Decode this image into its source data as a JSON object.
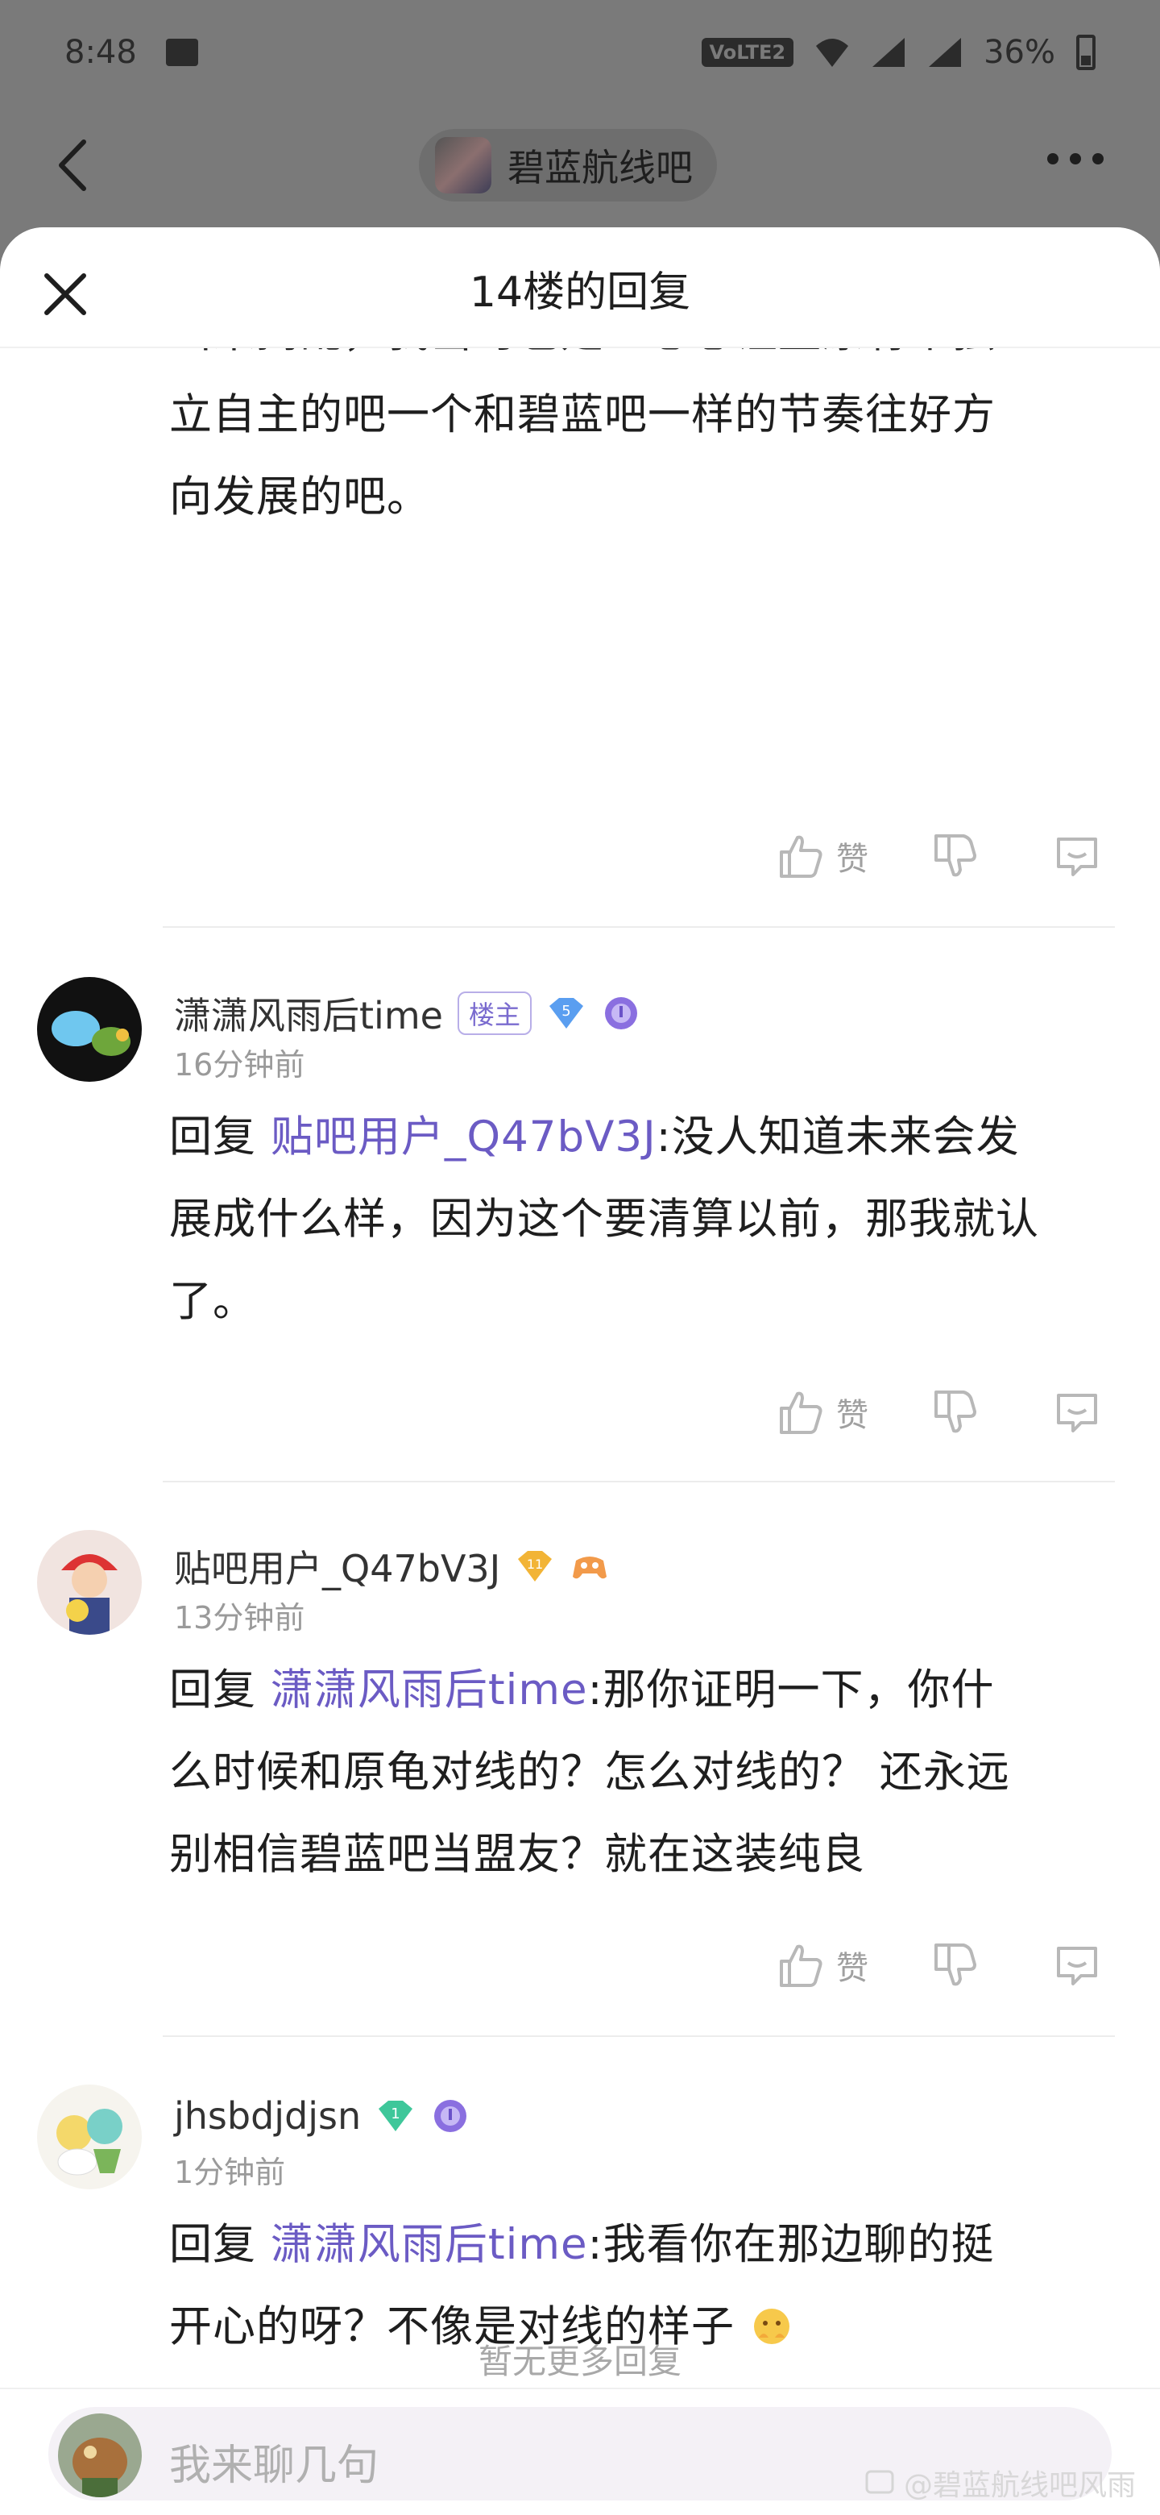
{
  "status_bar": {
    "time": "8:48",
    "network": "VoLTE2",
    "battery": "36%"
  },
  "forum": {
    "name": "碧蓝航线吧"
  },
  "sheet": {
    "title": "14楼的回复"
  },
  "first_block": {
    "lines": [
      "出来捣乱，我当时也是一心想让蓝原有个独",
      "立自主的吧一个和碧蓝吧一样的节奏往好方",
      "向发展的吧。"
    ]
  },
  "like_label": "赞",
  "replies": [
    {
      "username": "潇潇风雨后time",
      "owner_badge": "楼主",
      "level": "5",
      "time": "16分钟前",
      "prefix": "回复 ",
      "mention": "贴吧用户_Q47bV3J",
      "lines": [
        ":没人知道未来会发",
        "展成什么样，因为这个要清算以前，那我就认",
        "了。"
      ]
    },
    {
      "username": "贴吧用户_Q47bV3J",
      "level": "11",
      "time": "13分钟前",
      "prefix": "回复 ",
      "mention": "潇潇风雨后time",
      "lines": [
        ":那你证明一下，你什",
        "么时候和原龟对线的？怎么对线的？ 还永远",
        "别相信碧蓝吧当盟友？就在这装纯良"
      ]
    },
    {
      "username": "jhsbdjdjsn",
      "level": "1",
      "time": "1分钟前",
      "prefix": "回复 ",
      "mention": "潇潇风雨后time",
      "lines": [
        ":我看你在那边聊的挺",
        "开心的呀？不像是对线的样子"
      ]
    }
  ],
  "end_note": "暂无更多回复",
  "input": {
    "placeholder": "我来聊几句"
  },
  "watermark": "@碧蓝航线吧风雨"
}
